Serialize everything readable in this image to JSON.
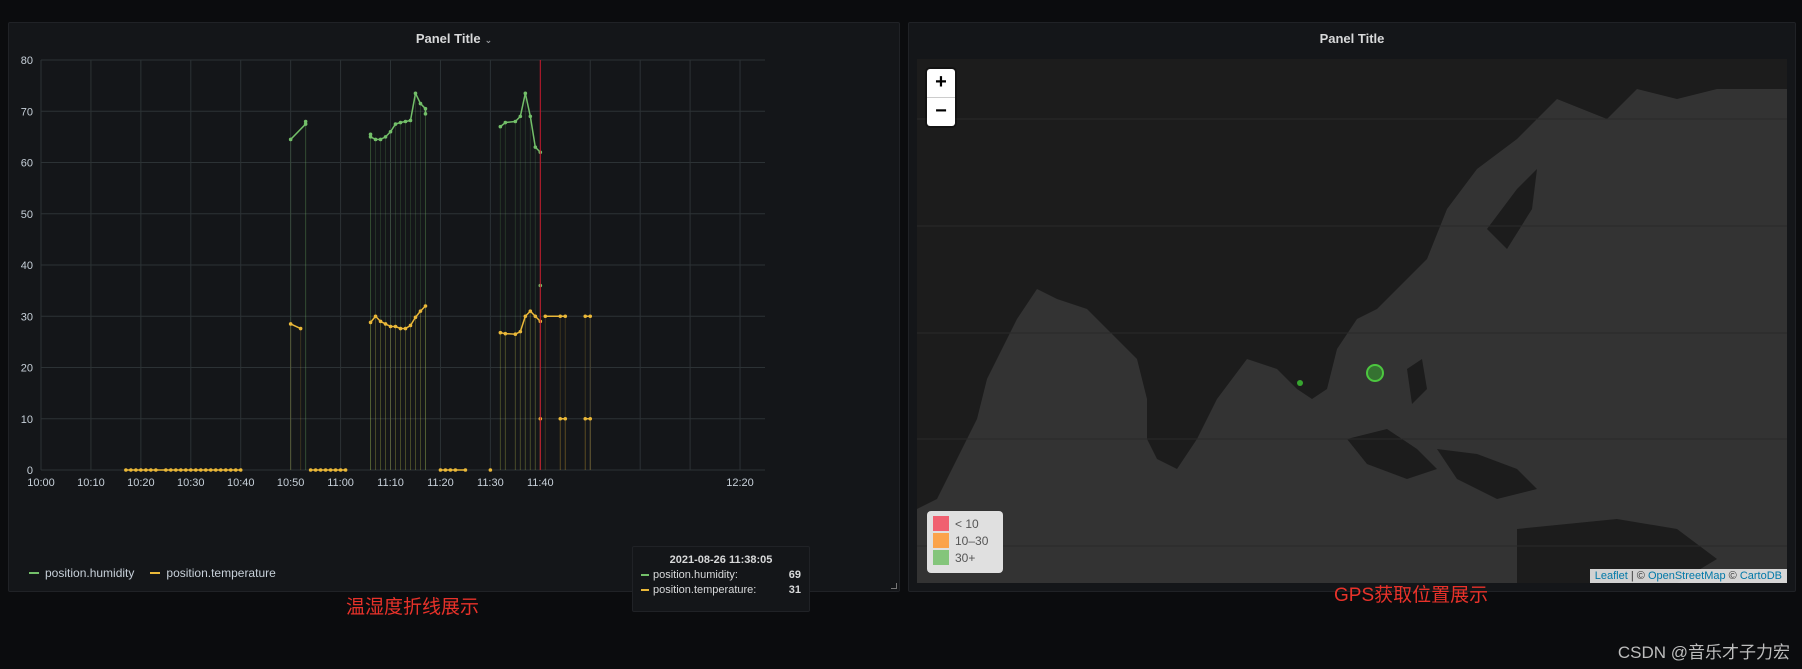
{
  "graph_panel": {
    "title": "Panel Title",
    "chart_data": {
      "type": "line",
      "x_ticks": [
        "10:00",
        "10:10",
        "10:20",
        "10:30",
        "10:40",
        "10:50",
        "11:00",
        "11:10",
        "11:20",
        "11:30",
        "11:40",
        "11:50",
        "12:00",
        "12:10",
        "12:20"
      ],
      "x_tick_labels": [
        "10:00",
        "10:10",
        "10:20",
        "10:30",
        "10:40",
        "10:50",
        "11:00",
        "11:10",
        "11:20",
        "11:30",
        "11:40",
        "",
        "",
        "",
        "12:20"
      ],
      "y_ticks": [
        0,
        10,
        20,
        30,
        40,
        50,
        60,
        70,
        80
      ],
      "ylim": [
        0,
        80
      ],
      "xlim": [
        "10:00",
        "12:25"
      ],
      "grid": true,
      "legend_placement": "bottom-left",
      "cursor_time": "11:40",
      "series": [
        {
          "name": "position.humidity",
          "color": "#73bf69",
          "points": [
            [
              "10:50",
              64.5
            ],
            [
              "10:53",
              67.5
            ],
            [
              "10:53",
              68
            ],
            [
              "11:06",
              65.5
            ],
            [
              "11:06",
              65
            ],
            [
              "11:07",
              64.5
            ],
            [
              "11:08",
              64.5
            ],
            [
              "11:09",
              65
            ],
            [
              "11:10",
              66
            ],
            [
              "11:11",
              67.5
            ],
            [
              "11:12",
              67.8
            ],
            [
              "11:13",
              68
            ],
            [
              "11:14",
              68.2
            ],
            [
              "11:15",
              73.5
            ],
            [
              "11:16",
              71.5
            ],
            [
              "11:17",
              70.5
            ],
            [
              "11:17",
              69.5
            ],
            [
              "11:32",
              67
            ],
            [
              "11:33",
              67.8
            ],
            [
              "11:35",
              68
            ],
            [
              "11:36",
              69
            ],
            [
              "11:37",
              73.5
            ],
            [
              "11:38",
              69
            ],
            [
              "11:39",
              63
            ],
            [
              "11:40",
              62
            ],
            [
              "11:40",
              36
            ]
          ]
        },
        {
          "name": "position.temperature",
          "color": "#eab839",
          "points": [
            [
              "10:17",
              0
            ],
            [
              "10:18",
              0
            ],
            [
              "10:19",
              0
            ],
            [
              "10:20",
              0
            ],
            [
              "10:21",
              0
            ],
            [
              "10:22",
              0
            ],
            [
              "10:23",
              0
            ],
            [
              "10:25",
              0
            ],
            [
              "10:26",
              0
            ],
            [
              "10:27",
              0
            ],
            [
              "10:28",
              0
            ],
            [
              "10:29",
              0
            ],
            [
              "10:30",
              0
            ],
            [
              "10:31",
              0
            ],
            [
              "10:32",
              0
            ],
            [
              "10:33",
              0
            ],
            [
              "10:34",
              0
            ],
            [
              "10:35",
              0
            ],
            [
              "10:36",
              0
            ],
            [
              "10:37",
              0
            ],
            [
              "10:38",
              0
            ],
            [
              "10:39",
              0
            ],
            [
              "10:40",
              0
            ],
            [
              "10:50",
              28.5
            ],
            [
              "10:52",
              27.6
            ],
            [
              "10:54",
              0
            ],
            [
              "10:55",
              0
            ],
            [
              "10:56",
              0
            ],
            [
              "10:57",
              0
            ],
            [
              "10:58",
              0
            ],
            [
              "10:59",
              0
            ],
            [
              "11:00",
              0
            ],
            [
              "11:01",
              0
            ],
            [
              "11:06",
              28.8
            ],
            [
              "11:07",
              30
            ],
            [
              "11:08",
              29
            ],
            [
              "11:09",
              28.5
            ],
            [
              "11:10",
              28
            ],
            [
              "11:11",
              28
            ],
            [
              "11:12",
              27.6
            ],
            [
              "11:13",
              27.6
            ],
            [
              "11:14",
              28.2
            ],
            [
              "11:15",
              29.8
            ],
            [
              "11:16",
              31
            ],
            [
              "11:17",
              32
            ],
            [
              "11:20",
              0
            ],
            [
              "11:21",
              0
            ],
            [
              "11:22",
              0
            ],
            [
              "11:23",
              0
            ],
            [
              "11:25",
              0
            ],
            [
              "11:30",
              0
            ],
            [
              "11:32",
              26.8
            ],
            [
              "11:33",
              26.6
            ],
            [
              "11:35",
              26.5
            ],
            [
              "11:36",
              27
            ],
            [
              "11:37",
              30
            ],
            [
              "11:38",
              31
            ],
            [
              "11:39",
              30
            ],
            [
              "11:40",
              29
            ],
            [
              "11:40",
              10
            ],
            [
              "11:41",
              30
            ],
            [
              "11:44",
              30
            ],
            [
              "11:45",
              30
            ],
            [
              "11:44",
              10
            ],
            [
              "11:45",
              10
            ],
            [
              "11:49",
              30
            ],
            [
              "11:50",
              30
            ],
            [
              "11:49",
              10
            ],
            [
              "11:50",
              10
            ]
          ]
        }
      ]
    },
    "tooltip": {
      "time": "2021-08-26 11:38:05",
      "rows": [
        {
          "name": "position.humidity:",
          "value": "69",
          "color": "#73bf69"
        },
        {
          "name": "position.temperature:",
          "value": "31",
          "color": "#eab839"
        }
      ]
    }
  },
  "map_panel": {
    "title": "Panel Title",
    "zoom_in": "+",
    "zoom_out": "−",
    "legend": [
      {
        "label": "< 10",
        "color": "#f2495c"
      },
      {
        "label": "10–30",
        "color": "#ff9830"
      },
      {
        "label": "30+",
        "color": "#73bf69"
      }
    ],
    "attribution": {
      "leaflet": "Leaflet",
      "sep1": " | © ",
      "osm": "OpenStreetMap",
      "sep2": " © ",
      "carto": "CartoDB"
    },
    "markers": [
      {
        "color": "#37a52f",
        "size": "large"
      },
      {
        "color": "#37a52f",
        "size": "small"
      }
    ]
  },
  "captions": {
    "left": "温湿度折线展示",
    "right": "GPS获取位置展示",
    "watermark": "CSDN @音乐才子力宏"
  }
}
